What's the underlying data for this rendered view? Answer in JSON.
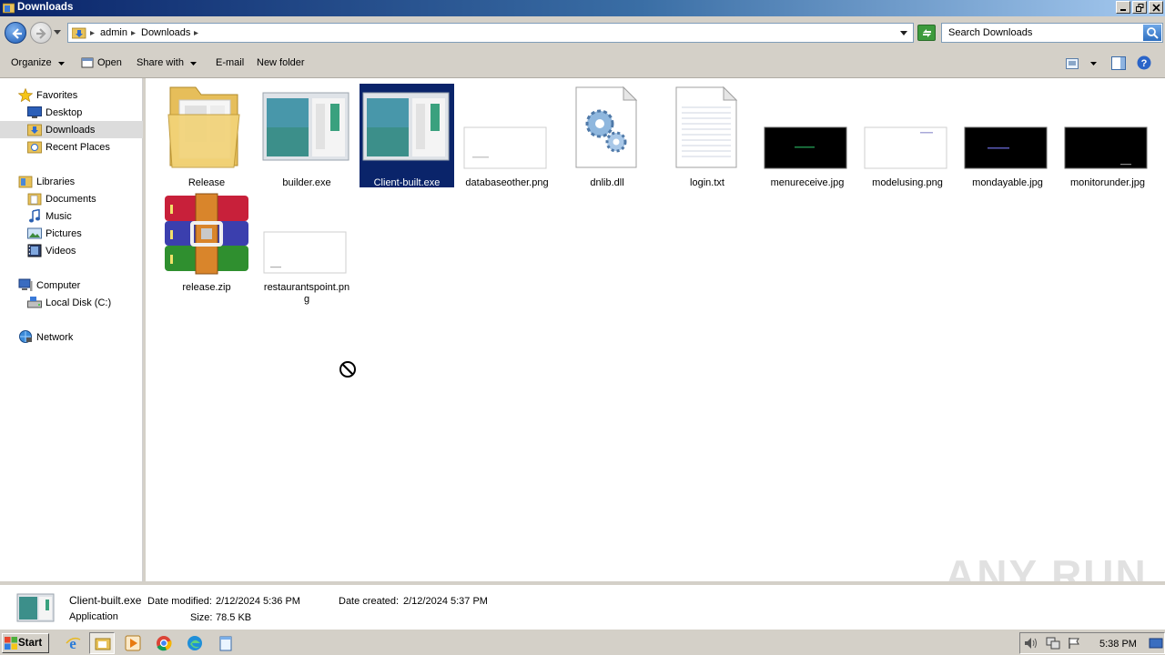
{
  "window": {
    "title": "Downloads"
  },
  "address": {
    "breadcrumbs": [
      "admin",
      "Downloads"
    ],
    "search_placeholder": "Search Downloads"
  },
  "toolbar": {
    "organize": "Organize",
    "open": "Open",
    "share_with": "Share with",
    "email": "E-mail",
    "new_folder": "New folder"
  },
  "sidebar": {
    "favorites": "Favorites",
    "desktop": "Desktop",
    "downloads": "Downloads",
    "recent_places": "Recent Places",
    "libraries": "Libraries",
    "documents": "Documents",
    "music": "Music",
    "pictures": "Pictures",
    "videos": "Videos",
    "computer": "Computer",
    "local_disk": "Local Disk (C:)",
    "network": "Network"
  },
  "files": [
    {
      "name": "Release",
      "type": "folder"
    },
    {
      "name": "builder.exe",
      "type": "exe"
    },
    {
      "name": "Client-built.exe",
      "type": "exe",
      "selected": true
    },
    {
      "name": "databaseother.png",
      "type": "png-white"
    },
    {
      "name": "dnlib.dll",
      "type": "dll"
    },
    {
      "name": "login.txt",
      "type": "txt"
    },
    {
      "name": "menureceive.jpg",
      "type": "jpg-black"
    },
    {
      "name": "modelusing.png",
      "type": "png-white"
    },
    {
      "name": "mondayable.jpg",
      "type": "jpg-black"
    },
    {
      "name": "monitorunder.jpg",
      "type": "jpg-black"
    },
    {
      "name": "release.zip",
      "type": "zip"
    },
    {
      "name": "restaurantspoint.png",
      "type": "png-white"
    }
  ],
  "details": {
    "name": "Client-built.exe",
    "type": "Application",
    "modified_label": "Date modified:",
    "modified_value": "2/12/2024 5:36 PM",
    "size_label": "Size:",
    "size_value": "78.5 KB",
    "created_label": "Date created:",
    "created_value": "2/12/2024 5:37 PM"
  },
  "taskbar": {
    "start": "Start",
    "clock": "5:38 PM"
  },
  "watermark": "ANY RUN"
}
